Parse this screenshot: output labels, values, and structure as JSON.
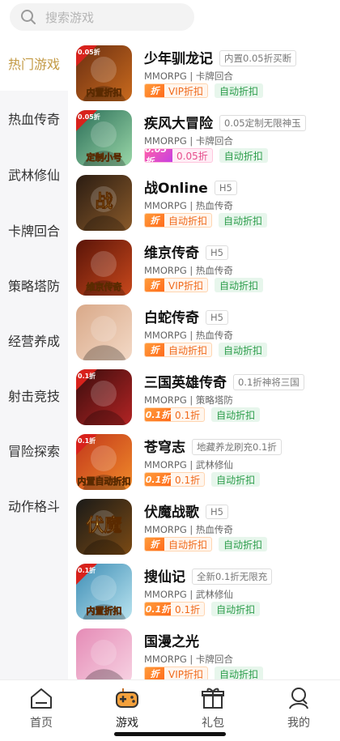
{
  "search": {
    "placeholder": "搜索游戏"
  },
  "sidebar": {
    "items": [
      {
        "label": "热门游戏",
        "active": true
      },
      {
        "label": "热血传奇"
      },
      {
        "label": "武林修仙"
      },
      {
        "label": "卡牌回合"
      },
      {
        "label": "策略塔防"
      },
      {
        "label": "经营养成"
      },
      {
        "label": "射击竞技"
      },
      {
        "label": "冒险探索"
      },
      {
        "label": "动作格斗"
      }
    ]
  },
  "games": [
    {
      "name": "少年驯龙记",
      "tag": "内置0.05折买断",
      "meta": "MMORPG | 卡牌回合",
      "discount_type": "vip",
      "discount_icon": "折",
      "discount_label": "VIP折扣",
      "auto_label": "自动折扣",
      "thumb_text": "内置折扣",
      "thumb_corner": "0.05折",
      "thumb_colors": [
        "#6b2f12",
        "#c96a1d"
      ]
    },
    {
      "name": "疾风大冒险",
      "tag": "0.05定制无限神玉",
      "meta": "MMORPG | 卡牌回合",
      "discount_type": "pink",
      "discount_icon": "0.05折",
      "discount_label": "0.05折",
      "auto_label": "自动折扣",
      "thumb_text": "定制小号",
      "thumb_corner": "0.05折",
      "thumb_colors": [
        "#2b6e58",
        "#9ad7a8"
      ]
    },
    {
      "name": "战Online",
      "tag": "H5",
      "meta": "MMORPG | 热血传奇",
      "discount_type": "orange",
      "discount_icon": "折",
      "discount_label": "自动折扣",
      "auto_label": "自动折扣",
      "thumb_text": "战",
      "thumb_corner": "",
      "thumb_colors": [
        "#2a1c12",
        "#8a5a2a"
      ]
    },
    {
      "name": "维京传奇",
      "tag": "H5",
      "meta": "MMORPG | 热血传奇",
      "discount_type": "vip",
      "discount_icon": "折",
      "discount_label": "VIP折扣",
      "auto_label": "自动折扣",
      "thumb_text": "维京传奇",
      "thumb_corner": "",
      "thumb_colors": [
        "#5a1408",
        "#c8481c"
      ]
    },
    {
      "name": "白蛇传奇",
      "tag": "H5",
      "meta": "MMORPG | 热血传奇",
      "discount_type": "orange",
      "discount_icon": "折",
      "discount_label": "自动折扣",
      "auto_label": "自动折扣",
      "thumb_text": "",
      "thumb_corner": "",
      "thumb_colors": [
        "#d9a989",
        "#f3d9c6"
      ]
    },
    {
      "name": "三国英雄传奇",
      "tag": "0.1折神将三国",
      "meta": "MMORPG | 策略塔防",
      "discount_type": "tenth",
      "discount_icon": "0.1折",
      "discount_label": "0.1折",
      "auto_label": "自动折扣",
      "thumb_text": "",
      "thumb_corner": "0.1折",
      "thumb_colors": [
        "#3a0d0d",
        "#b32424"
      ]
    },
    {
      "name": "苍穹志",
      "tag": "地藏养龙刷充0.1折",
      "meta": "MMORPG | 武林修仙",
      "discount_type": "tenth",
      "discount_icon": "0.1折",
      "discount_label": "0.1折",
      "auto_label": "自动折扣",
      "thumb_text": "内置自动折扣",
      "thumb_corner": "0.1折",
      "thumb_colors": [
        "#c2371b",
        "#f08a2a"
      ]
    },
    {
      "name": "伏魔战歌",
      "tag": "H5",
      "meta": "MMORPG | 热血传奇",
      "discount_type": "orange",
      "discount_icon": "折",
      "discount_label": "自动折扣",
      "auto_label": "自动折扣",
      "thumb_text": "伏魔",
      "thumb_corner": "",
      "thumb_colors": [
        "#1a1a18",
        "#7b4a14"
      ]
    },
    {
      "name": "搜仙记",
      "tag": "全新0.1折无限充",
      "meta": "MMORPG | 武林修仙",
      "discount_type": "tenth",
      "discount_icon": "0.1折",
      "discount_label": "0.1折",
      "auto_label": "自动折扣",
      "thumb_text": "内置折扣",
      "thumb_corner": "0.1折",
      "thumb_colors": [
        "#3d8db5",
        "#b9e3ef"
      ]
    },
    {
      "name": "国漫之光",
      "tag": "",
      "meta": "MMORPG | 卡牌回合",
      "discount_type": "vip",
      "discount_icon": "折",
      "discount_label": "VIP折扣",
      "auto_label": "自动折扣",
      "thumb_text": "",
      "thumb_corner": "",
      "thumb_colors": [
        "#e58bb6",
        "#f7d3e3"
      ]
    }
  ],
  "bottom_nav": {
    "items": [
      {
        "label": "首页",
        "icon": "home-icon"
      },
      {
        "label": "游戏",
        "icon": "gamepad-icon",
        "active": true
      },
      {
        "label": "礼包",
        "icon": "gift-icon"
      },
      {
        "label": "我的",
        "icon": "profile-icon"
      }
    ]
  },
  "colors": {
    "accent": "#c39a45",
    "orange": "#f06a1c",
    "green": "#2c9d4b",
    "pink": "#e64d8c"
  }
}
